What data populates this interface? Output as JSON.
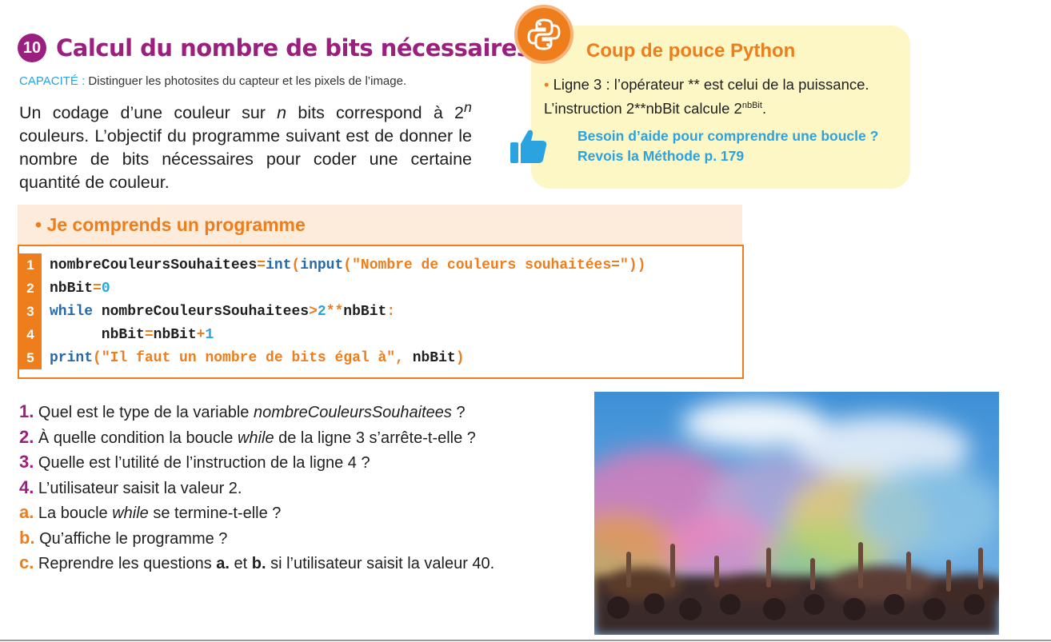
{
  "exercise": {
    "number": "10",
    "title": "Calcul du nombre de bits nécessaires",
    "capacity_label": "CAPACITÉ :",
    "capacity_text": " Distinguer les photosites du capteur et les pixels de l’image.",
    "intro_a": "Un codage d’une couleur sur ",
    "intro_n": "n",
    "intro_b": " bits correspond à 2",
    "intro_sup": "n",
    "intro_c": " couleurs. L’objectif du programme suivant est de donner le nombre de bits nécessaires pour coder une certaine quantité de couleur."
  },
  "help": {
    "title": "Coup de pouce Python",
    "bullet": "•",
    "line1": " Ligne 3 : l’opérateur ** est celui de la puissance.",
    "line2a": "L’instruction 2**nbBit calcule 2",
    "line2sup": "nbBit",
    "line2b": ".",
    "link1": "Besoin d’aide pour comprendre une boucle ?",
    "link2": "Revois la Méthode p. 179",
    "badge_icon": "python-logo-icon",
    "thumb_icon": "thumbs-up-icon"
  },
  "program": {
    "header": "• Je comprends un programme",
    "lines": [
      {
        "n": "1",
        "parts": [
          "nombreCouleursSouhaitees",
          "=",
          "int",
          "(",
          "input",
          "(",
          "\"Nombre de couleurs souhaitées=\"",
          "))"
        ]
      },
      {
        "n": "2",
        "parts": [
          "nbBit",
          "=",
          "0"
        ]
      },
      {
        "n": "3",
        "parts": [
          "while",
          " nombreCouleursSouhaitees",
          ">",
          "2",
          "**",
          "nbBit",
          ":"
        ]
      },
      {
        "n": "4",
        "parts": [
          "      nbBit",
          "=",
          "nbBit",
          "+",
          "1"
        ]
      },
      {
        "n": "5",
        "parts": [
          "print",
          "(",
          "\"Il faut un nombre de bits égal à\"",
          ", ",
          "nbBit",
          ")"
        ]
      }
    ]
  },
  "questions": [
    {
      "num": "1.",
      "a": " Quel est le type de la variable ",
      "em": "nombreCouleursSouhaitees",
      "b": " ?"
    },
    {
      "num": "2.",
      "a": " À quelle condition la boucle ",
      "em": "while",
      "b": " de la ligne 3 s’arrête-t-elle ?"
    },
    {
      "num": "3.",
      "a": " Quelle est l’utilité de l’instruction de la ligne 4 ?",
      "em": "",
      "b": ""
    },
    {
      "num": "4.",
      "a": " L’utilisateur saisit la valeur 2.",
      "em": "",
      "b": ""
    }
  ],
  "subquestions": [
    {
      "letter": "a.",
      "a": " La boucle ",
      "em": "while",
      "b": " se termine-t-elle ?"
    },
    {
      "letter": "b.",
      "a": " Qu’affiche le programme ?",
      "em": "",
      "b": ""
    },
    {
      "letter": "c.",
      "a": " Reprendre les questions ",
      "s1": "a.",
      "mid": " et ",
      "s2": "b.",
      "b": " si l’utilisateur saisit la valeur 40."
    }
  ],
  "colors": {
    "purple": "#9b1f7f",
    "orange": "#ee7d1c",
    "blue": "#2aa3e0",
    "keyword_blue": "#2569a8",
    "help_bg": "#fdf6c5",
    "header_bg": "#fdebdc"
  }
}
